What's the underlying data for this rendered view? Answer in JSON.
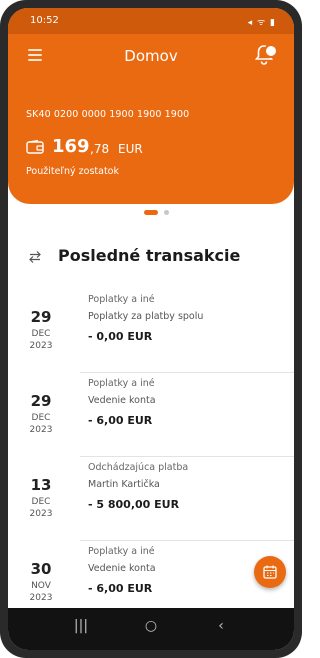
{
  "statusbar": {
    "time": "10:52",
    "icons": "◂ ᯤ ▮"
  },
  "appbar": {
    "title": "Domov"
  },
  "account": {
    "iban": "SK40 0200 0000 1900 1900 1900",
    "amount_int": "169",
    "amount_dec": ",78",
    "currency": "EUR",
    "balance_label": "Použiteľný zostatok"
  },
  "section": {
    "title": "Posledné transakcie"
  },
  "transactions": [
    {
      "day": "29",
      "month": "DEC",
      "year": "2023",
      "category": "Poplatky a iné",
      "description": "Poplatky za platby spolu",
      "amount": "- 0,00 EUR"
    },
    {
      "day": "29",
      "month": "DEC",
      "year": "2023",
      "category": "Poplatky a iné",
      "description": "Vedenie konta",
      "amount": "- 6,00 EUR"
    },
    {
      "day": "13",
      "month": "DEC",
      "year": "2023",
      "category": "Odchádzajúca platba",
      "description": "Martin Kartička",
      "amount": "- 5 800,00 EUR"
    },
    {
      "day": "30",
      "month": "NOV",
      "year": "2023",
      "category": "Poplatky a iné",
      "description": "Vedenie konta",
      "amount": "- 6,00 EUR"
    }
  ],
  "navbar": {
    "recents": "|||",
    "home": "○",
    "back": "‹"
  },
  "colors": {
    "accent": "#ea6a12",
    "status": "#cf5a0b"
  },
  "icons": [
    "menu-icon",
    "bell-icon",
    "wallet-icon",
    "swap-arrows-icon",
    "calendar-icon"
  ]
}
